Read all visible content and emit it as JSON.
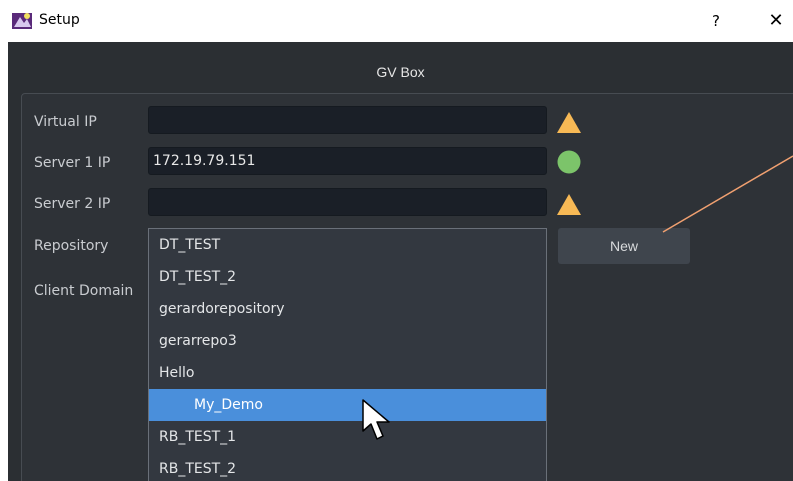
{
  "window": {
    "title": "Setup",
    "help_label": "?",
    "close_label": "✕"
  },
  "group": {
    "title": "GV Box"
  },
  "fields": {
    "virtual_ip": {
      "label": "Virtual IP",
      "value": "",
      "status": "warning"
    },
    "server1_ip": {
      "label": "Server 1 IP",
      "value": "172.19.79.151",
      "status": "ok"
    },
    "server2_ip": {
      "label": "Server 2 IP",
      "value": "",
      "status": "warning"
    },
    "repository": {
      "label": "Repository"
    },
    "client_domain": {
      "label": "Client Domain"
    }
  },
  "new_button": {
    "label": "New"
  },
  "repository_options": [
    "DT_TEST",
    "DT_TEST_2",
    "gerardorepository",
    "gerarrepo3",
    "Hello",
    "My_Demo",
    "RB_TEST_1",
    "RB_TEST_2"
  ],
  "selected_repository": "My_Demo",
  "colors": {
    "warning": "#f7b955",
    "ok": "#7cc46a",
    "selection": "#4a8fdb",
    "annotation": "#f0a070"
  }
}
